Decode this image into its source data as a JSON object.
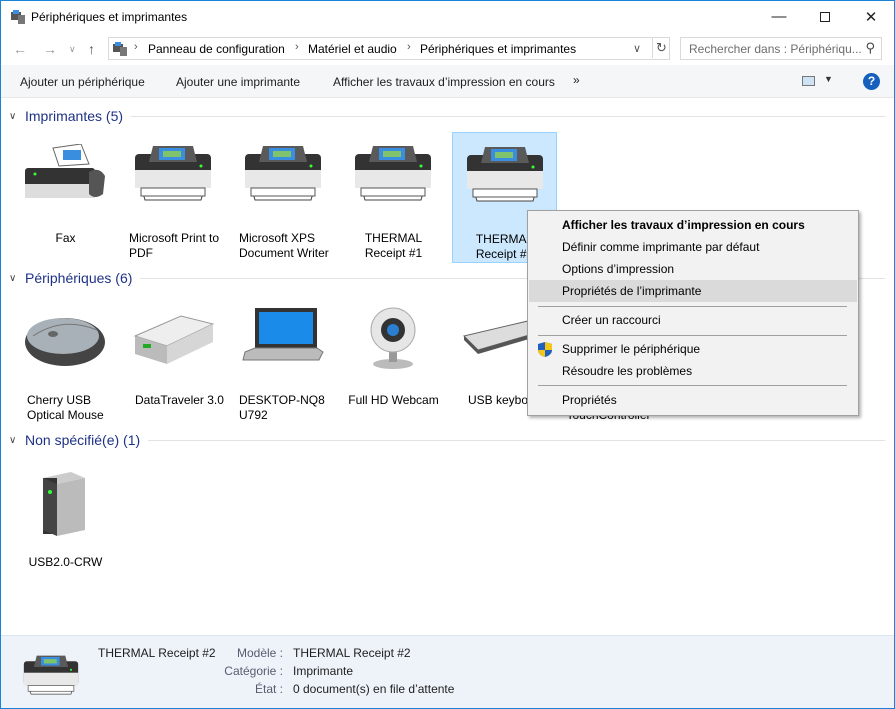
{
  "window": {
    "title": "Périphériques et imprimantes",
    "icon": "devices-printers-icon"
  },
  "address": {
    "breadcrumbs": [
      "Panneau de configuration",
      "Matériel et audio",
      "Périphériques et imprimantes"
    ]
  },
  "search": {
    "placeholder": "Rechercher dans : Périphériqu..."
  },
  "toolbar": {
    "items": [
      "Ajouter un périphérique",
      "Ajouter une imprimante",
      "Afficher les travaux d’impression en cours"
    ],
    "more": "»"
  },
  "sections": [
    {
      "title": "Imprimantes (5)",
      "items": [
        {
          "label": "Fax",
          "icon": "fax-icon"
        },
        {
          "label": "Microsoft Print to PDF",
          "icon": "printer-icon"
        },
        {
          "label": "Microsoft XPS Document Writer",
          "icon": "printer-icon"
        },
        {
          "label": "THERMAL Receipt #1",
          "icon": "printer-icon"
        },
        {
          "label": "THERMAL Receipt #2",
          "icon": "printer-icon",
          "selected": true
        }
      ]
    },
    {
      "title": "Périphériques (6)",
      "items": [
        {
          "label": "Cherry USB Optical Mouse",
          "icon": "mouse-icon"
        },
        {
          "label": "DataTraveler 3.0",
          "icon": "usb-drive-icon"
        },
        {
          "label": "DESKTOP-NQ8U792",
          "icon": "laptop-icon"
        },
        {
          "label": "Full HD Webcam",
          "icon": "webcam-icon"
        },
        {
          "label": "USB keyboard",
          "icon": "keyboard-icon"
        },
        {
          "label": "TouchController",
          "icon": "device-icon"
        }
      ]
    },
    {
      "title": "Non spécifié(e) (1)",
      "items": [
        {
          "label": "USB2.0-CRW",
          "icon": "storage-tower-icon"
        }
      ]
    }
  ],
  "context_menu": {
    "items": [
      {
        "label": "Afficher les travaux d’impression en cours",
        "bold": true
      },
      {
        "label": "Définir comme imprimante par défaut"
      },
      {
        "label": "Options d’impression"
      },
      {
        "label": "Propriétés de l’imprimante",
        "highlighted": true
      },
      {
        "label": "Créer un raccourci"
      },
      {
        "label": "Supprimer le périphérique",
        "icon": "uac-shield-icon"
      },
      {
        "label": "Résoudre les problèmes"
      },
      {
        "label": "Propriétés"
      }
    ]
  },
  "details": {
    "name": "THERMAL Receipt #2",
    "fields": [
      {
        "key": "Modèle :",
        "value": "THERMAL Receipt #2"
      },
      {
        "key": "Catégorie :",
        "value": "Imprimante"
      },
      {
        "key": "État :",
        "value": "0 document(s) en file d’attente"
      }
    ]
  },
  "colors": {
    "accent": "#1883d7",
    "section_header": "#1e3287",
    "selection": "#cce8ff"
  }
}
